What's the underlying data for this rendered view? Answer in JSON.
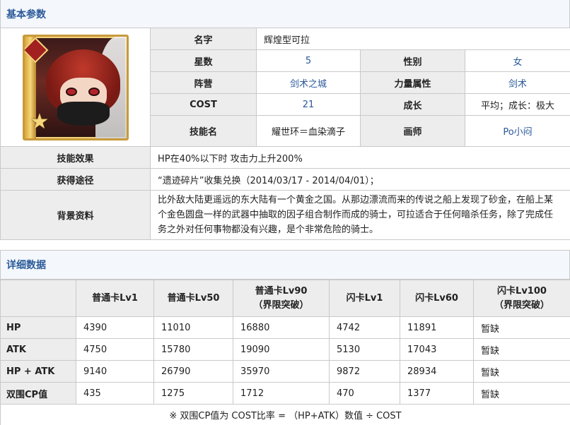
{
  "basic_section": {
    "title": "基本参数",
    "fields": {
      "name_label": "名字",
      "name_value": "辉煌型可拉",
      "stars_label": "星数",
      "stars_value": "5",
      "gender_label": "性别",
      "gender_value": "女",
      "faction_label": "阵营",
      "faction_value": "剑术之城",
      "attribute_label": "力量属性",
      "attribute_value": "剑术",
      "cost_label": "COST",
      "cost_value": "21",
      "growth_label": "成长",
      "growth_value": "平均；成长：极大",
      "skill_label": "技能名",
      "skill_value": "耀世环＝血染滴子",
      "artist_label": "画师",
      "artist_value": "Po小闷",
      "effect_label": "技能效果",
      "effect_value": "HP在40%以下时 攻击力上升200%",
      "obtain_label": "获得途径",
      "obtain_value": "“遗迹碎片”收集兑换（2014/03/17 - 2014/04/01）；",
      "background_label": "背景资料",
      "background_value": "比外敌大陆更遥远的东大陆有一个黄金之国。从那边漂流而来的传说之船上发现了砂金，在船上某个金色圆盘一样的武器中抽取的因子组合制作而成的骑士，可拉适合于任何暗杀任务，除了完成任务之外对任何事物都没有兴趣，是个非常危险的骑士。"
    }
  },
  "detail_section": {
    "title": "详细数据",
    "columns": [
      "普通卡Lv1",
      "普通卡Lv50",
      "普通卡Lv90",
      "（界限突破）",
      "闪卡Lv1",
      "闪卡Lv60",
      "闪卡Lv100",
      "（界限突破）"
    ],
    "rows": [
      {
        "label": "HP",
        "values": [
          "4390",
          "11010",
          "16880",
          "4742",
          "11891",
          "暂缺"
        ]
      },
      {
        "label": "ATK",
        "values": [
          "4750",
          "15780",
          "19090",
          "5130",
          "17043",
          "暂缺"
        ]
      },
      {
        "label": "HP + ATK",
        "values": [
          "9140",
          "26790",
          "35970",
          "9872",
          "28934",
          "暂缺"
        ]
      },
      {
        "label": "双围CP值",
        "values": [
          "435",
          "1275",
          "1712",
          "470",
          "1377",
          "暂缺"
        ]
      }
    ],
    "note": "※ 双围CP值为 COST比率 = （HP+ATK）数值 ÷ COST"
  }
}
